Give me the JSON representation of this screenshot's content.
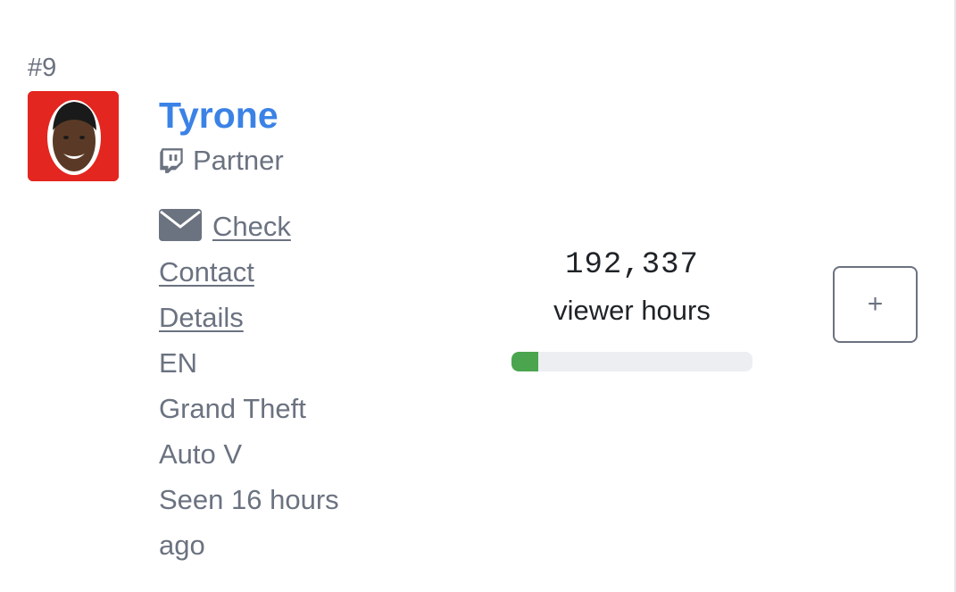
{
  "rank": "#9",
  "streamer": {
    "name": "Tyrone",
    "badge": "Partner",
    "badge_icon": "twitch-icon",
    "avatar_bg": "#e3261f"
  },
  "details": {
    "contact_icon": "mail-icon",
    "contact_link_line1": "Check",
    "contact_link_line2": "Contact",
    "contact_link_line3": "Details",
    "language": "EN",
    "game_line1": "Grand Theft",
    "game_line2": "Auto V",
    "seen_line1": "Seen 16 hours",
    "seen_line2": "ago"
  },
  "stats": {
    "viewer_hours": "192,337",
    "viewer_hours_label": "viewer hours",
    "bar_fraction": 0.11,
    "bar_color": "#4aa54e"
  },
  "actions": {
    "add_label": "+"
  },
  "colors": {
    "accent": "#3b82e6",
    "text_muted": "#6b7280"
  }
}
